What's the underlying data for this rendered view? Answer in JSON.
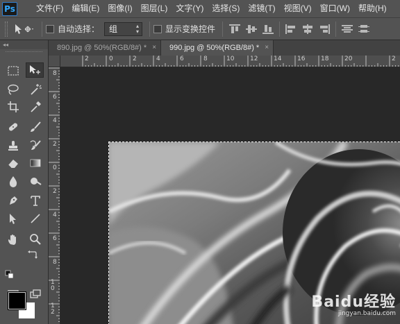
{
  "app": {
    "logo": "Ps"
  },
  "menu": [
    "文件(F)",
    "编辑(E)",
    "图像(I)",
    "图层(L)",
    "文字(Y)",
    "选择(S)",
    "滤镜(T)",
    "视图(V)",
    "窗口(W)",
    "帮助(H)"
  ],
  "options": {
    "auto_select_label": "自动选择：",
    "auto_select_value": "组",
    "show_transform_label": "显示变换控件"
  },
  "tabs": [
    {
      "label": "890.jpg @ 50%(RGB/8#) *",
      "close": "×",
      "active": false
    },
    {
      "label": "990.jpg @ 50%(RGB/8#) *",
      "close": "×",
      "active": true
    }
  ],
  "toolbox": {
    "collapse_glyph": "◂◂"
  },
  "ruler": {
    "top_labels": [
      "2",
      "0",
      "2",
      "4",
      "6",
      "8",
      "10",
      "12",
      "14",
      "16",
      "18",
      "20",
      "2"
    ],
    "left_labels": [
      "8",
      "6",
      "4",
      "2",
      "0",
      "2",
      "4",
      "6",
      "8",
      "1 0",
      "1 2"
    ]
  },
  "colors": {
    "foreground": "#000000",
    "background": "#ffffff",
    "ui_panel": "#535353",
    "canvas_bg": "#282828"
  },
  "watermark": {
    "main": "Baidu经验",
    "sub": "jingyan.baidu.com"
  }
}
